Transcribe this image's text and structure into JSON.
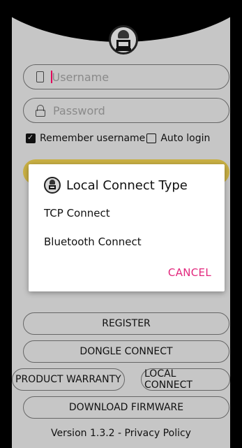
{
  "login": {
    "username_placeholder": "Username",
    "password_placeholder": "Password",
    "remember_label": "Remember username",
    "autologin_label": "Auto login",
    "remember_checked": true,
    "autologin_checked": false
  },
  "buttons": {
    "register": "REGISTER",
    "dongle_connect": "DONGLE CONNECT",
    "product_warranty": "PRODUCT WARRANTY",
    "local_connect": "LOCAL CONNECT",
    "download_firmware": "DOWNLOAD FIRMWARE"
  },
  "footer": {
    "version": "Version 1.3.2",
    "separator": " - ",
    "privacy": "Privacy Policy"
  },
  "dialog": {
    "title": "Local Connect Type",
    "options": [
      "TCP Connect",
      "Bluetooth Connect"
    ],
    "cancel": "CANCEL"
  },
  "colors": {
    "accent": "#e2287d",
    "login_button": "#c9b044"
  }
}
